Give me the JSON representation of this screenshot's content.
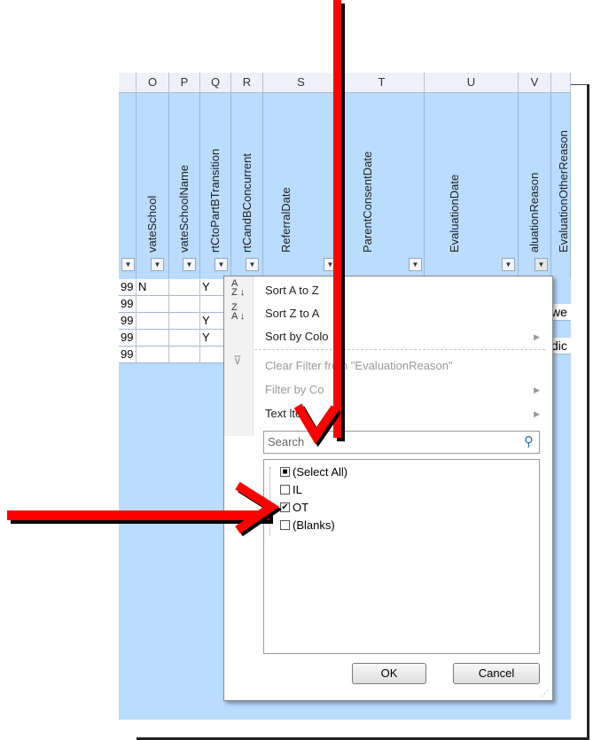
{
  "columns": {
    "letters": [
      "O",
      "P",
      "Q",
      "R",
      "S",
      "T",
      "U",
      "V"
    ],
    "headers": [
      "vateSchool",
      "vateSchoolName",
      "rtCtoPartBTransition",
      "rtCandBConcurrent",
      "ReferralDate",
      "ParentConsentDate",
      "EvaluationDate",
      "aluationReason",
      "EvaluationOtherReason"
    ]
  },
  "rows": [
    {
      "a": "99",
      "b": "N",
      "c": "",
      "d": "Y"
    },
    {
      "a": "99",
      "b": "",
      "c": "",
      "d": ""
    },
    {
      "a": "99",
      "b": "",
      "c": "",
      "d": "Y"
    },
    {
      "a": "99",
      "b": "",
      "c": "",
      "d": "Y"
    },
    {
      "a": "99",
      "b": "",
      "c": "",
      "d": ""
    }
  ],
  "right_cells": [
    "we",
    "dic"
  ],
  "menu": {
    "sort_az": "Sort A to Z",
    "sort_za": "Sort Z to A",
    "sort_color": "Sort by Colo",
    "clear_filter": "Clear Filter from \"EvaluationReason\"",
    "filter_color": "Filter by Co",
    "text_filters": "Text  lte",
    "search_placeholder": "Search",
    "items": [
      {
        "label": "(Select All)",
        "state": "■"
      },
      {
        "label": "IL",
        "state": ""
      },
      {
        "label": "OT",
        "state": "✔"
      },
      {
        "label": "(Blanks)",
        "state": ""
      }
    ],
    "ok": "OK",
    "cancel": "Cancel"
  },
  "colors": {
    "sheet": "#b9dcff",
    "arrow": "#ff0000"
  }
}
